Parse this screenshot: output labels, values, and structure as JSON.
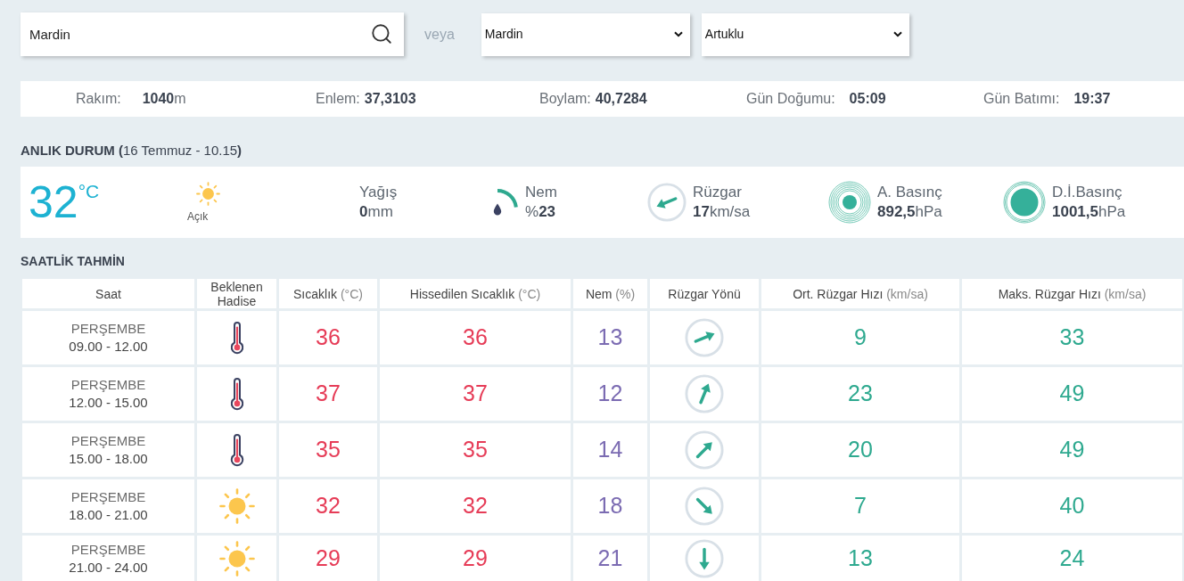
{
  "search": {
    "value": "Mardin"
  },
  "separator": "veya",
  "selects": [
    {
      "value": "Mardin"
    },
    {
      "value": "Artuklu"
    }
  ],
  "location_info": [
    {
      "label": "Rakım:",
      "value": "1040",
      "unit": "m"
    },
    {
      "label": "Enlem:",
      "value": "37,3103"
    },
    {
      "label": "Boylam:",
      "value": "40,7284"
    },
    {
      "label": "Gün Doğumu:",
      "value": "05:09"
    },
    {
      "label": "Gün Batımı:",
      "value": "19:37"
    }
  ],
  "current": {
    "title": "**ANLIK DURUM (**16 Temmuz - 10.15**)**",
    "temperature": "32",
    "temperature_unit": "°C",
    "condition": {
      "kind": "clear",
      "label": "Açık"
    },
    "items": [
      {
        "kind": "precipitation",
        "label": "Yağış",
        "value": "0",
        "unit": "mm"
      },
      {
        "kind": "humidity",
        "label": "Nem",
        "prefix": "%",
        "value": "23"
      },
      {
        "kind": "wind",
        "label": "Rüzgar",
        "value": "17",
        "unit": "km/sa",
        "arrow": {
          "kind": "wsw"
        }
      },
      {
        "kind": "station_pressure",
        "label": "A. Basınç",
        "value": "892,5",
        "unit": "hPa"
      },
      {
        "kind": "sea_level_pressure",
        "label": "D.İ.Basınç",
        "value": "1001,5",
        "unit": "hPa"
      }
    ]
  },
  "forecast": {
    "title": "SAATLİK TAHMİN",
    "columns": [
      {
        "label": "Saat"
      },
      {
        "label": "Beklenen Hadise"
      },
      {
        "label": "Sıcaklık",
        "unit": "(°C)"
      },
      {
        "label": "Hissedilen Sıcaklık",
        "unit": "(°C)"
      },
      {
        "label": "Nem",
        "unit": "(%)"
      },
      {
        "label": "Rüzgar Yönü"
      },
      {
        "label": "Ort. Rüzgar Hızı",
        "unit": "(km/sa)"
      },
      {
        "label": "Maks. Rüzgar Hızı",
        "unit": "(km/sa)"
      }
    ],
    "rows": [
      {
        "day": "PERŞEMBE",
        "time": "09.00 - 12.00",
        "condition": {
          "kind": "hot"
        },
        "temperature": "36",
        "feels_like": "36",
        "humidity": "13",
        "arrow": {
          "kind": "ene"
        },
        "wind_avg": "9",
        "wind_max": "33"
      },
      {
        "day": "PERŞEMBE",
        "time": "12.00 - 15.00",
        "condition": {
          "kind": "hot"
        },
        "temperature": "37",
        "feels_like": "37",
        "humidity": "12",
        "arrow": {
          "kind": "nne"
        },
        "wind_avg": "23",
        "wind_max": "49"
      },
      {
        "day": "PERŞEMBE",
        "time": "15.00 - 18.00",
        "condition": {
          "kind": "hot"
        },
        "temperature": "35",
        "feels_like": "35",
        "humidity": "14",
        "arrow": {
          "kind": "ne"
        },
        "wind_avg": "20",
        "wind_max": "49"
      },
      {
        "day": "PERŞEMBE",
        "time": "18.00 - 21.00",
        "condition": {
          "kind": "clear"
        },
        "temperature": "32",
        "feels_like": "32",
        "humidity": "18",
        "arrow": {
          "kind": "se"
        },
        "wind_avg": "7",
        "wind_max": "40"
      },
      {
        "day": "PERŞEMBE",
        "time": "21.00 - 24.00",
        "condition": {
          "kind": "clear"
        },
        "temperature": "29",
        "feels_like": "29",
        "humidity": "21",
        "arrow": {
          "kind": "s"
        },
        "wind_avg": "13",
        "wind_max": "24"
      }
    ]
  }
}
